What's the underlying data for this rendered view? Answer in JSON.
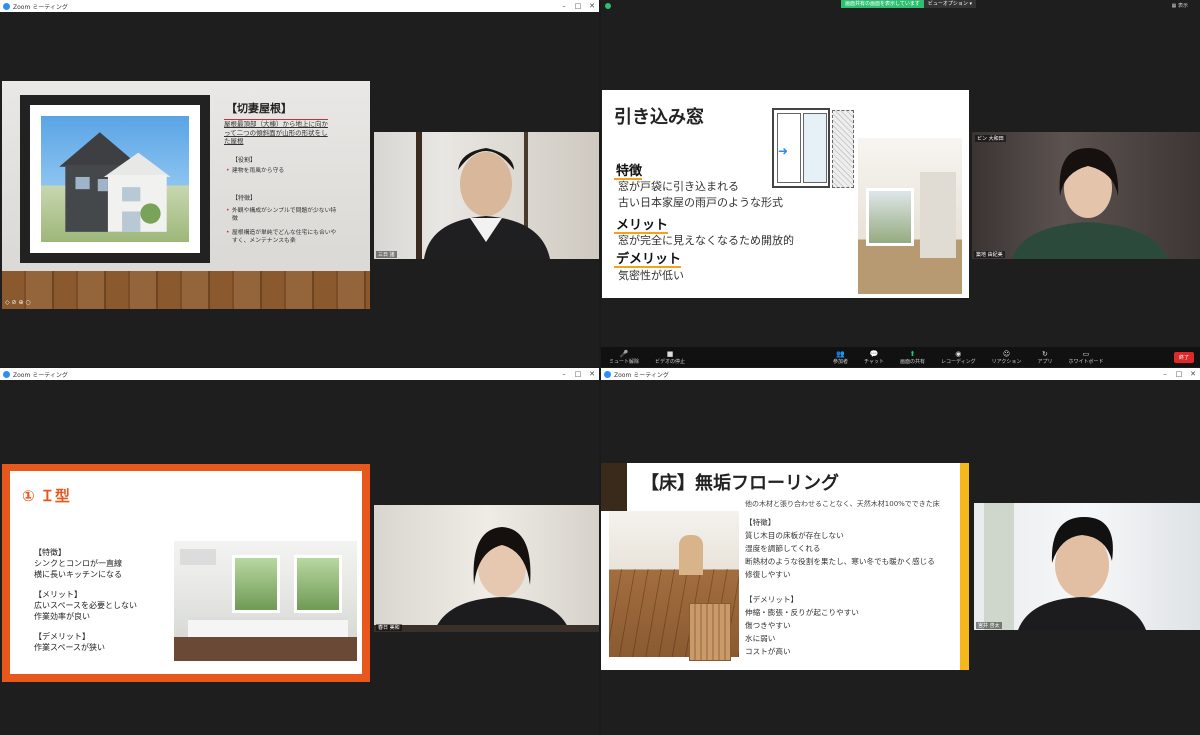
{
  "windows": [
    {
      "title": "Zoom ミーティング",
      "slide": {
        "title": "【切妻屋根】",
        "lead": "屋根最頂部（大棟）から地上に向かって二つの傾斜面が山形の形状をした屋根",
        "role_label": "【役割】",
        "role_items": [
          "建物を雨風から守る"
        ],
        "feature_label": "【特徴】",
        "feature_items": [
          "外観や構成がシンプルで問題が少ない特徴",
          "屋根構造が単純でどんな住宅にも合いやすく、メンテナンスも楽"
        ],
        "tools": "◇ ⊘ ⊕ ○"
      },
      "camera_name": "三日   諸"
    },
    {
      "sharing_banner": "画面共有の画面を表示しています",
      "view_options": "ビューオプション ▾",
      "view_label": "表示",
      "slide": {
        "title": "引き込み窓",
        "feature_head": "特徴",
        "feature_lines": [
          "窓が戸袋に引き込まれる",
          "古い日本家屋の雨戸のような形式"
        ],
        "merit_head": "メリット",
        "merit_line": "窓が完全に見えなくなるため開放的",
        "demerit_head": "デメリット",
        "demerit_line": "気密性が低い",
        "arrow": "➜"
      },
      "camera_name": "築地 由紀美",
      "camera_badge": "ピン 大和田",
      "toolbar": [
        {
          "icon": "mic-icon",
          "glyph": "🎤",
          "label": "ミュート解除"
        },
        {
          "icon": "video-icon",
          "glyph": "■",
          "label": "ビデオの停止"
        },
        {
          "icon": "participants-icon",
          "glyph": "👥",
          "label": "参加者"
        },
        {
          "icon": "chat-icon",
          "glyph": "💬",
          "label": "チャット"
        },
        {
          "icon": "share-screen-icon",
          "glyph": "⬆",
          "label": "画面の共有"
        },
        {
          "icon": "record-icon",
          "glyph": "◉",
          "label": "レコーディング"
        },
        {
          "icon": "reaction-icon",
          "glyph": "☺",
          "label": "リアクション"
        },
        {
          "icon": "apps-icon",
          "glyph": "↻",
          "label": "アプリ"
        },
        {
          "icon": "whiteboard-icon",
          "glyph": "▭",
          "label": "ホワイトボード"
        }
      ],
      "end_label": "終了"
    },
    {
      "title": "Zoom ミーティング",
      "slide": {
        "title": "① Ｉ型",
        "feature_label": "【特徴】",
        "feature_lines": [
          "シンクとコンロが一直線",
          "横に長いキッチンになる"
        ],
        "merit_label": "【メリット】",
        "merit_lines": [
          "広いスペースを必要としない",
          "作業効率が良い"
        ],
        "demerit_label": "【デメリット】",
        "demerit_lines": [
          "作業スペースが狭い"
        ]
      },
      "camera_name": "春日 美和"
    },
    {
      "title": "Zoom ミーティング",
      "slide": {
        "title": "【床】無垢フローリング",
        "subtitle": "他の木材と張り合わせることなく、天然木材100%でできた床",
        "feature_label": "【特徴】",
        "feature_lines": [
          "質じ木目の床板が存在しない",
          "湿度を調節してくれる",
          "断熱材のような役割を果たし、寒い冬でも暖かく感じる",
          "修復しやすい"
        ],
        "demerit_label": "【デメリット】",
        "demerit_lines": [
          "伸縮・膨張・反りが起こりやすい",
          "傷つきやすい",
          "水に弱い",
          "コストが高い"
        ]
      },
      "camera_name": "宮井 啓太"
    }
  ],
  "colors": {
    "zoom_blue": "#2d8cff",
    "accent_red": "#c0314a",
    "slide_orange": "#e8581c",
    "slide_yellow": "#f5b71c",
    "highlight_yellow": "#f3a21a",
    "end_red": "#e02828",
    "share_green": "#2fbf71"
  }
}
